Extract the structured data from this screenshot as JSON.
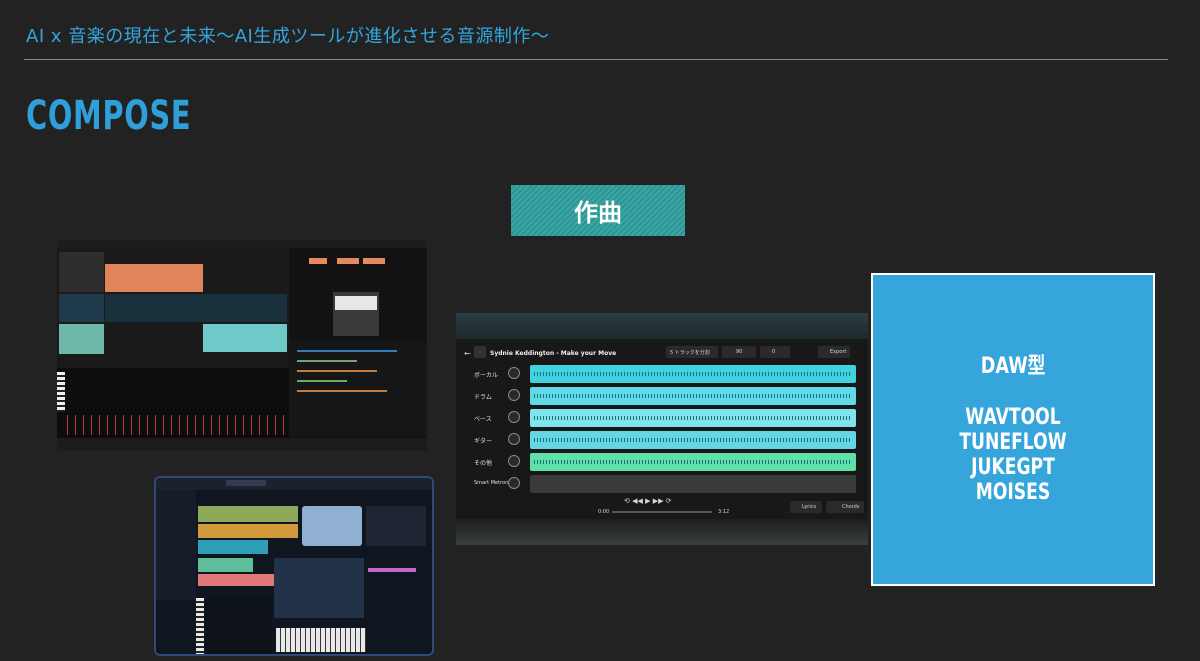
{
  "header": {
    "title": "AI x 音楽の現在と未来〜AI生成ツールが進化させる音源制作〜"
  },
  "section": {
    "title": "COMPOSE"
  },
  "badge": {
    "label": "作曲"
  },
  "screenshots": {
    "daw_editor": {
      "alt": "DAW editor screenshot"
    },
    "daw_app": {
      "alt": "DAW application screenshot"
    },
    "stem_player": {
      "song_title": "Sydnie Keddington - Make your Move",
      "stem_select": "5 トラックを分割",
      "bpm": "90",
      "key": "0",
      "export_label": "Export",
      "tracks": [
        "ボーカル",
        "ドラム",
        "ベース",
        "ギター",
        "その他",
        "Smart Metronome"
      ],
      "time_start": "0:00",
      "time_end": "3:12",
      "lyrics_label": "Lyrics",
      "chords_label": "Chords"
    }
  },
  "info_box": {
    "title": "DAW型",
    "tools": [
      "WAVTOOL",
      "TUNEFLOW",
      "JUKEGPT",
      "MOISES"
    ]
  },
  "colors": {
    "background": "#222222",
    "accent_blue": "#32a6dd",
    "badge_teal": "#3aa7a6",
    "box_blue": "#36a5dc",
    "track_cyan": "#3fd3e0",
    "track_green": "#5fe0a8"
  }
}
